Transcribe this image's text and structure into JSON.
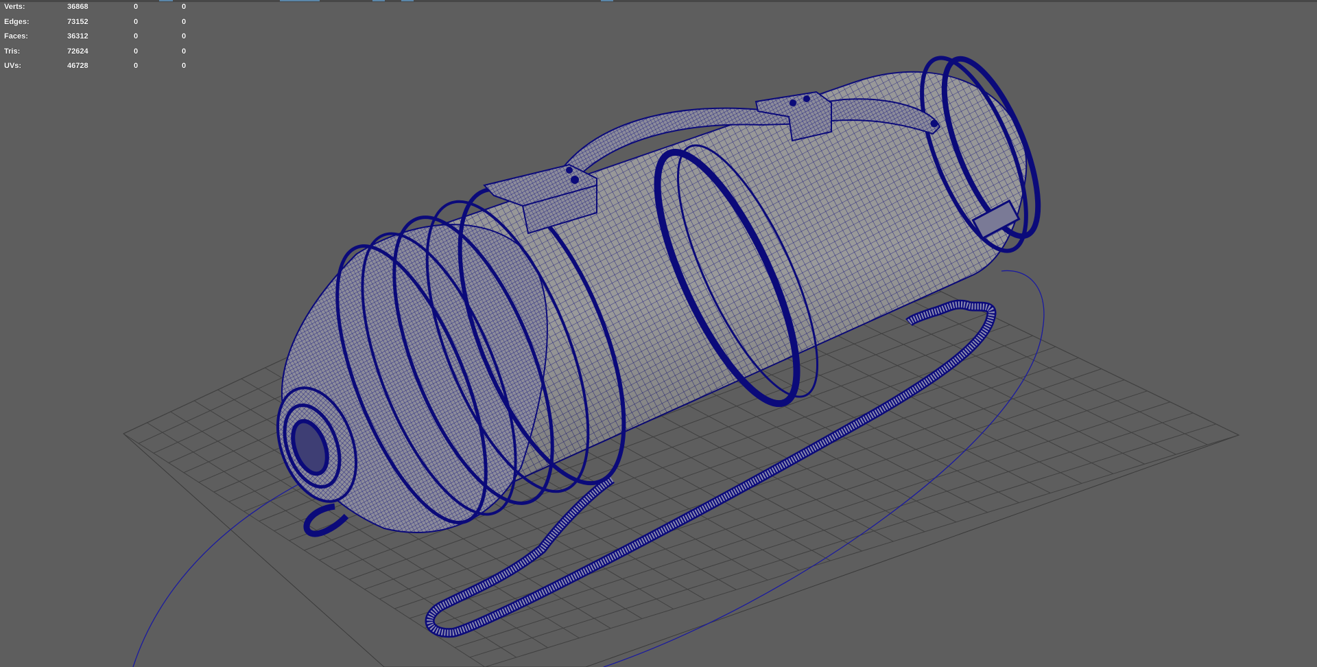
{
  "viewport": {
    "background": "#5e5e5e",
    "wire_color": "#0b0a7a",
    "grid_color": "#3e3e3e",
    "mesh_fill": "#9a9a9a"
  },
  "hud": {
    "rows": [
      {
        "label": "Verts:",
        "values": [
          "36868",
          "0",
          "0"
        ]
      },
      {
        "label": "Edges:",
        "values": [
          "73152",
          "0",
          "0"
        ]
      },
      {
        "label": "Faces:",
        "values": [
          "36312",
          "0",
          "0"
        ]
      },
      {
        "label": "Tris:",
        "values": [
          "72624",
          "0",
          "0"
        ]
      },
      {
        "label": "UVs:",
        "values": [
          "46728",
          "0",
          "0"
        ]
      }
    ]
  }
}
